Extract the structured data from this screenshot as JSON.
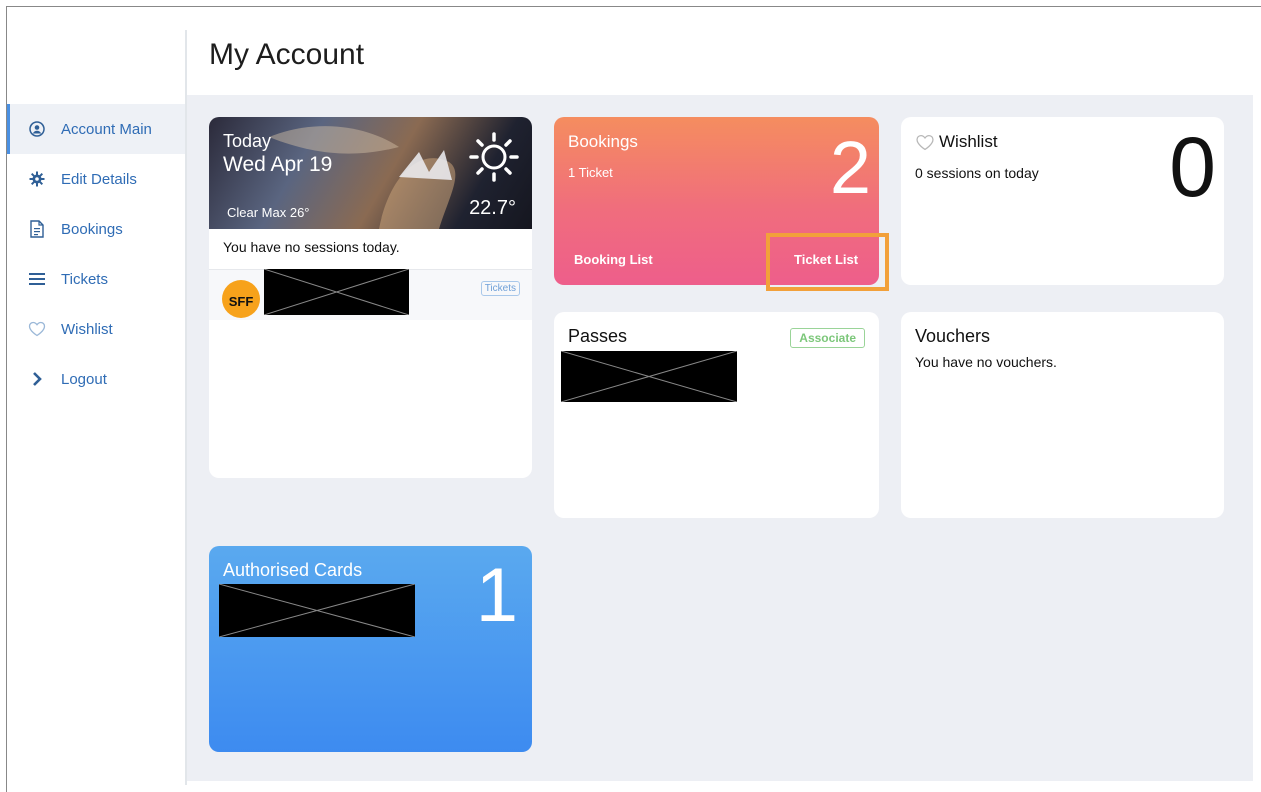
{
  "page_title": "My Account",
  "sidebar": {
    "items": [
      {
        "label": "Account Main",
        "icon": "user-circle-icon",
        "active": true
      },
      {
        "label": "Edit Details",
        "icon": "gear-icon"
      },
      {
        "label": "Bookings",
        "icon": "document-icon"
      },
      {
        "label": "Tickets",
        "icon": "list-icon"
      },
      {
        "label": "Wishlist",
        "icon": "heart-icon"
      },
      {
        "label": "Logout",
        "icon": "chevron-right-icon"
      }
    ]
  },
  "today_card": {
    "label": "Today",
    "date": "Wed Apr 19",
    "condition": "Clear Max 26°",
    "temperature": "22.7°",
    "no_sessions": "You have no sessions today.",
    "tickets_tag": "Tickets",
    "logo_text": "SFF"
  },
  "bookings_card": {
    "title": "Bookings",
    "subtitle": "1 Ticket",
    "count": "2",
    "booking_list": "Booking List",
    "ticket_list": "Ticket List"
  },
  "wishlist_card": {
    "title": "Wishlist",
    "subtitle": "0 sessions on today",
    "count": "0"
  },
  "passes_card": {
    "title": "Passes",
    "associate": "Associate"
  },
  "vouchers_card": {
    "title": "Vouchers",
    "subtitle": "You have no vouchers."
  },
  "cards_card": {
    "title": "Authorised Cards",
    "count": "1"
  },
  "colors": {
    "accent": "#4a90e2",
    "bookings_gradient": [
      "#f58d5f",
      "#ee5e8b"
    ],
    "cards_gradient": [
      "#5aa9ef",
      "#3d8bf0"
    ],
    "highlight": "#f2a03a"
  }
}
